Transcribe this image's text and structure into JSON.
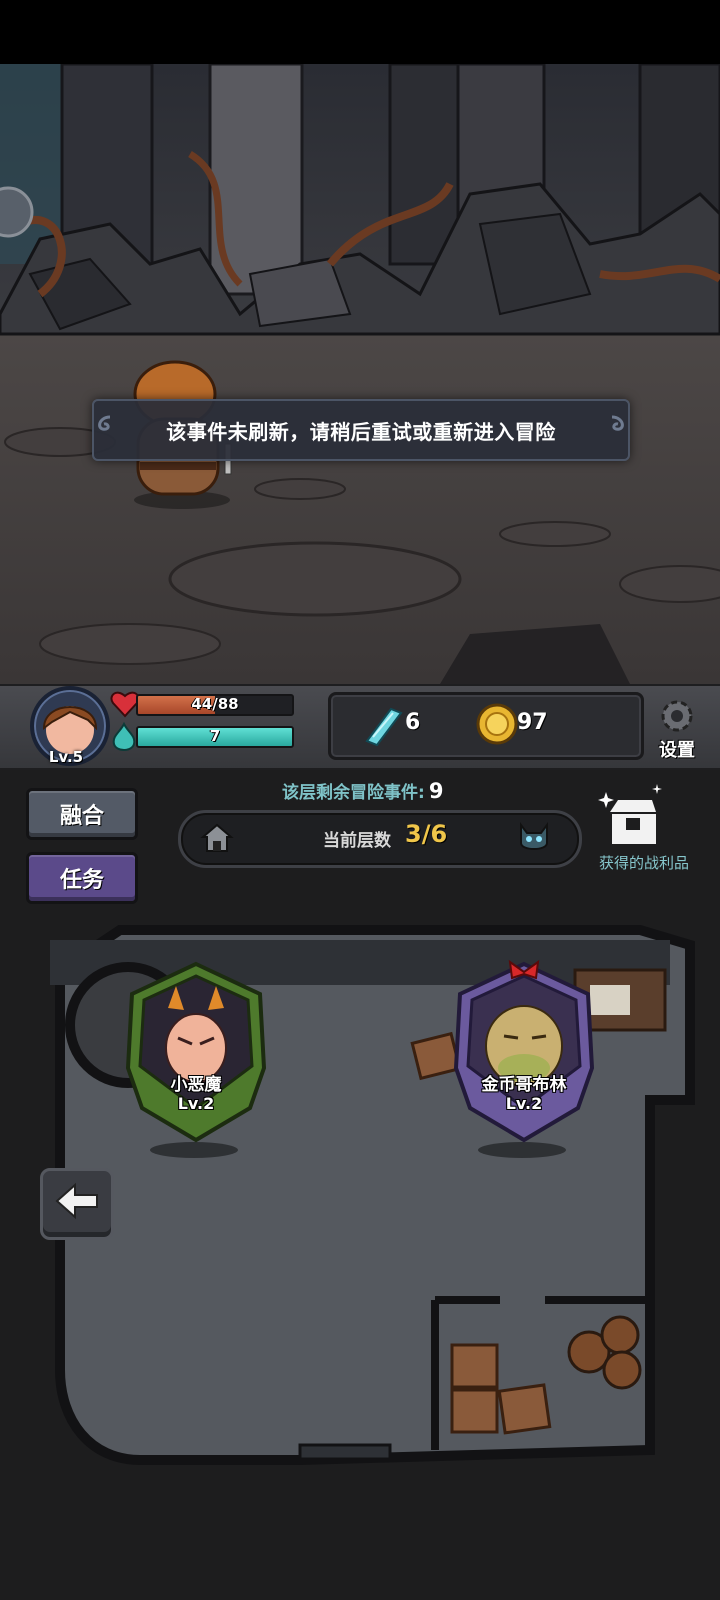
{
  "toast": {
    "message": "该事件未刷新，请稍后重试或重新进入冒险"
  },
  "player": {
    "level_label": "Lv.5",
    "hp_text": "44/88",
    "hp_fraction": 0.5,
    "mp_text": "7",
    "mp_fraction": 1.0
  },
  "resources": {
    "crystals": "6",
    "gold": "97"
  },
  "settings_label": "设置",
  "buttons": {
    "merge": "融合",
    "task": "任务"
  },
  "floor": {
    "remaining_label": "该层剩余冒险事件:",
    "remaining_count": "9",
    "current_label": "当前层数",
    "current_value": "3/6"
  },
  "loot_label": "获得的战利品",
  "enemies": [
    {
      "name": "小恶魔",
      "level": "Lv.2",
      "frame_color": "#4e7a2c"
    },
    {
      "name": "金币哥布林",
      "level": "Lv.2",
      "frame_color": "#6b5a9e"
    }
  ],
  "colors": {
    "hp": "#c45a3a",
    "mp": "#3fbfb6",
    "gold": "#f0c64a",
    "accent_teal": "#7fc3c8"
  },
  "icons": [
    "heart-icon",
    "mana-potion-icon",
    "crystal-icon",
    "gold-coin-icon",
    "gear-icon",
    "house-icon",
    "demon-head-icon",
    "treasure-chest-icon",
    "back-arrow-icon"
  ]
}
